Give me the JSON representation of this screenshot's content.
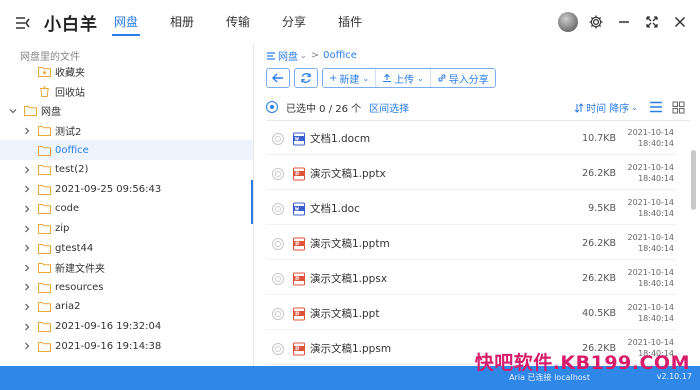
{
  "app": {
    "name": "小白羊",
    "colors": {
      "accent": "#2b7de9",
      "statusbar": "#2f87e8",
      "watermark": "#d81c6b",
      "doc_icon": "#3a5fcd",
      "ppt_icon": "#e0533b"
    }
  },
  "tabs": [
    {
      "label": "网盘",
      "active": true
    },
    {
      "label": "相册",
      "active": false
    },
    {
      "label": "传输",
      "active": false
    },
    {
      "label": "分享",
      "active": false
    },
    {
      "label": "插件",
      "active": false
    }
  ],
  "sidebar": {
    "title": "网盘里的文件",
    "items": [
      {
        "label": "收藏夹",
        "icon": "star-folder-icon",
        "indent": 1,
        "arrow": ""
      },
      {
        "label": "回收站",
        "icon": "trash-icon",
        "indent": 1,
        "arrow": ""
      },
      {
        "label": "网盘",
        "icon": "folder-icon",
        "indent": 0,
        "arrow": "down"
      },
      {
        "label": "测试2",
        "icon": "folder-icon",
        "indent": 1,
        "arrow": "right"
      },
      {
        "label": "0office",
        "icon": "folder-icon",
        "indent": 1,
        "arrow": "",
        "selected": true
      },
      {
        "label": "test(2)",
        "icon": "folder-icon",
        "indent": 1,
        "arrow": "right"
      },
      {
        "label": "2021-09-25 09:56:43",
        "icon": "folder-icon",
        "indent": 1,
        "arrow": "right"
      },
      {
        "label": "code",
        "icon": "folder-icon",
        "indent": 1,
        "arrow": "right"
      },
      {
        "label": "zip",
        "icon": "folder-icon",
        "indent": 1,
        "arrow": "right"
      },
      {
        "label": "gtest44",
        "icon": "folder-icon",
        "indent": 1,
        "arrow": "right"
      },
      {
        "label": "新建文件夹",
        "icon": "folder-icon",
        "indent": 1,
        "arrow": "right"
      },
      {
        "label": "resources",
        "icon": "folder-icon",
        "indent": 1,
        "arrow": "right"
      },
      {
        "label": "aria2",
        "icon": "folder-icon",
        "indent": 1,
        "arrow": "right"
      },
      {
        "label": "2021-09-16 19:32:04",
        "icon": "folder-icon",
        "indent": 1,
        "arrow": "right"
      },
      {
        "label": "2021-09-16 19:14:38",
        "icon": "folder-icon",
        "indent": 1,
        "arrow": "right"
      }
    ]
  },
  "breadcrumb": {
    "root": "网盘",
    "current": "0office",
    "separator": ">"
  },
  "toolbar": {
    "new_label": "新建",
    "upload_label": "上传",
    "import_share_label": "导入分享"
  },
  "selection": {
    "count_text": "已选中 0 / 26 个",
    "range_select": "区间选择"
  },
  "sort": {
    "label": "时间 降序"
  },
  "files": [
    {
      "name": "文档1.docm",
      "type": "doc",
      "size": "10.7KB",
      "date": "2021-10-14",
      "time": "18:40:14"
    },
    {
      "name": "演示文稿1.pptx",
      "type": "ppt",
      "size": "26.2KB",
      "date": "2021-10-14",
      "time": "18:40:14"
    },
    {
      "name": "文档1.doc",
      "type": "doc",
      "size": "9.5KB",
      "date": "2021-10-14",
      "time": "18:40:14"
    },
    {
      "name": "演示文稿1.pptm",
      "type": "ppt",
      "size": "26.2KB",
      "date": "2021-10-14",
      "time": "18:40:14"
    },
    {
      "name": "演示文稿1.ppsx",
      "type": "ppt",
      "size": "26.2KB",
      "date": "2021-10-14",
      "time": "18:40:14"
    },
    {
      "name": "演示文稿1.ppt",
      "type": "ppt",
      "size": "40.5KB",
      "date": "2021-10-14",
      "time": "18:40:14"
    },
    {
      "name": "演示文稿1.ppsm",
      "type": "ppt",
      "size": "26.2KB",
      "date": "2021-10-14",
      "time": "18:40:14"
    }
  ],
  "status": {
    "text": "Aria 已连接 localhost",
    "version": "v2.10.17"
  },
  "watermark": "快吧软件.KB199.COM"
}
